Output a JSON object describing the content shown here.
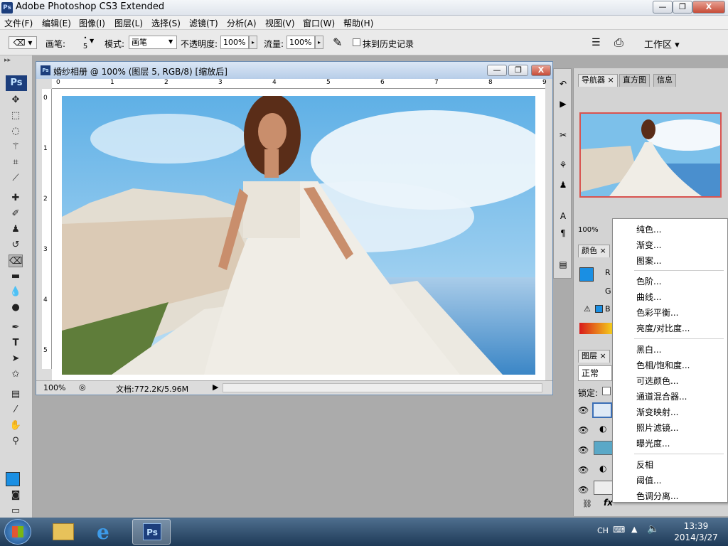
{
  "window": {
    "title": "Adobe Photoshop CS3 Extended",
    "app_icon": "Ps"
  },
  "window_buttons": {
    "minimize": "—",
    "restore": "❐",
    "close": "X"
  },
  "menu": [
    "文件(F)",
    "编辑(E)",
    "图像(I)",
    "图层(L)",
    "选择(S)",
    "滤镜(T)",
    "分析(A)",
    "视图(V)",
    "窗口(W)",
    "帮助(H)"
  ],
  "options": {
    "brush_label": "画笔:",
    "brush_size": "5",
    "mode_label": "模式:",
    "mode_value": "画笔",
    "opacity_label": "不透明度:",
    "opacity_value": "100%",
    "flow_label": "流量:",
    "flow_value": "100%",
    "history_label": "抹到历史记录",
    "workspace": "工作区 ▾"
  },
  "toolbox": {
    "logo": "Ps"
  },
  "document": {
    "title": "婚纱相册 @ 100% (图层 5, RGB/8) [缩放后]",
    "zoom": "100%",
    "doc_info": "文档:772.2K/5.96M",
    "ruler_top": [
      "0",
      "1",
      "2",
      "3",
      "4",
      "5",
      "6",
      "7",
      "8",
      "9"
    ],
    "ruler_left": [
      "0",
      "1",
      "2",
      "3",
      "4",
      "5"
    ]
  },
  "panels": {
    "nav_tabs": [
      "导航器",
      "直方图",
      "信息"
    ],
    "nav_zoom": "100%",
    "color_tab": "颜色",
    "color_labels": [
      "R",
      "G",
      "B"
    ],
    "layers_tab": "图层",
    "blend_mode": "正常",
    "lock_label": "锁定:",
    "fx_label": "fx"
  },
  "context_menu": {
    "group1": [
      "纯色...",
      "渐变...",
      "图案..."
    ],
    "group2": [
      "色阶...",
      "曲线...",
      "色彩平衡...",
      "亮度/对比度..."
    ],
    "group3": [
      "黑白...",
      "色相/饱和度...",
      "可选颜色...",
      "通道混合器...",
      "渐变映射...",
      "照片滤镜...",
      "曝光度..."
    ],
    "group4": [
      "反相",
      "阈值...",
      "色调分离..."
    ]
  },
  "taskbar": {
    "lang": "CH",
    "time": "13:39",
    "date": "2014/3/27",
    "ps_label": "Ps"
  },
  "colors": {
    "accent": "#1a8fe3",
    "title_blue": "#1c3e7c",
    "menu_highlight": "#d9534f"
  }
}
